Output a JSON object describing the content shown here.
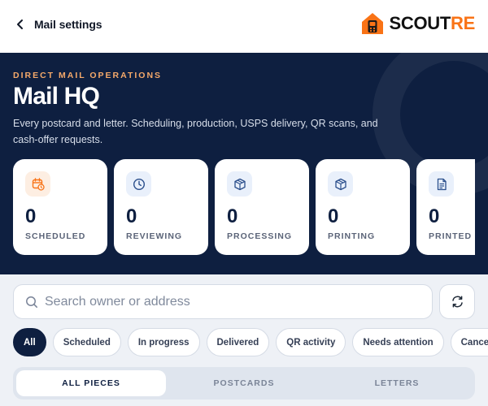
{
  "header": {
    "back_label": "Mail settings",
    "brand_prefix": "SCOUT",
    "brand_suffix": "RE",
    "brand_accent_color": "#f97316"
  },
  "hero": {
    "eyebrow": "DIRECT MAIL OPERATIONS",
    "title": "Mail HQ",
    "description": "Every postcard and letter. Scheduling, production, USPS delivery, QR scans, and cash-offer requests.",
    "background_color": "#0e1f40"
  },
  "stats": [
    {
      "icon": "calendar-clock-icon",
      "value": "0",
      "label": "SCHEDULED"
    },
    {
      "icon": "clock-icon",
      "value": "0",
      "label": "REVIEWING"
    },
    {
      "icon": "package-icon",
      "value": "0",
      "label": "PROCESSING"
    },
    {
      "icon": "package-icon",
      "value": "0",
      "label": "PRINTING"
    },
    {
      "icon": "document-icon",
      "value": "0",
      "label": "PRINTED"
    }
  ],
  "search": {
    "placeholder": "Search owner or address",
    "value": ""
  },
  "filters": [
    "All",
    "Scheduled",
    "In progress",
    "Delivered",
    "QR activity",
    "Needs attention",
    "Cancelled"
  ],
  "active_filter": "All",
  "tabs": [
    "ALL PIECES",
    "POSTCARDS",
    "LETTERS"
  ],
  "active_tab": "ALL PIECES"
}
